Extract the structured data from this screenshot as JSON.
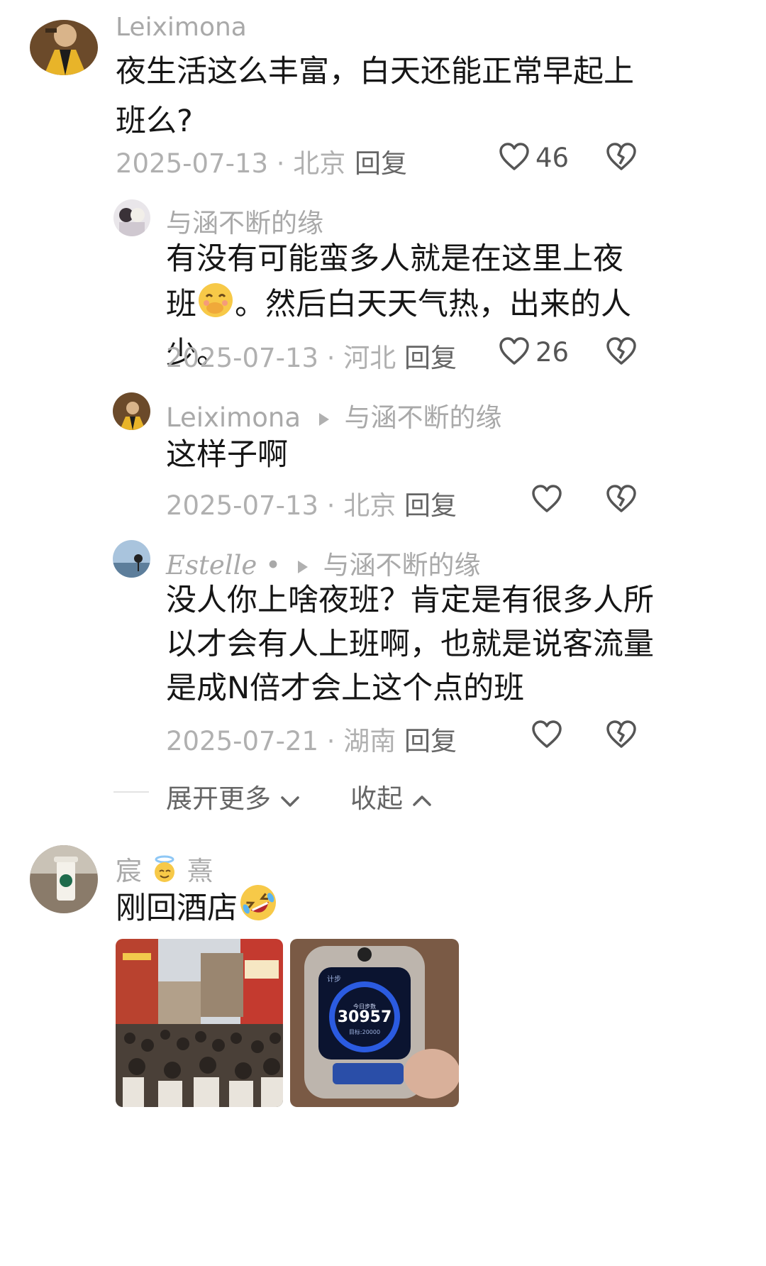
{
  "comments": [
    {
      "username": "Leiximona",
      "text": "夜生活这么丰富，白天还能正常早起上班么?",
      "meta": "2025-07-13 · 北京",
      "reply_label": "回复",
      "likes": "46",
      "replies": [
        {
          "username": "与涵不断的缘",
          "text_part1": "有没有可能蛮多人就是在这里上夜班",
          "emoji": "face-with-hand-over-mouth",
          "text_part2": "。然后白天天气热，出来的人少。",
          "meta": "2025-07-13 · 河北",
          "reply_label": "回复",
          "likes": "26"
        },
        {
          "username": "Leiximona",
          "reply_to": "与涵不断的缘",
          "text": "这样子啊",
          "meta": "2025-07-13 · 北京",
          "reply_label": "回复",
          "likes": ""
        },
        {
          "username": "Estelle •",
          "reply_to": "与涵不断的缘",
          "text": "没人你上啥夜班？肯定是有很多人所以才会有人上班啊，也就是说客流量是成N倍才会上这个点的班",
          "meta": "2025-07-21 · 湖南",
          "reply_label": "回复",
          "likes": ""
        }
      ],
      "expand_more": "展开更多",
      "collapse": "收起"
    },
    {
      "username_part1": "宸",
      "username_emoji": "smiling-face-with-halo",
      "username_part2": "熹",
      "text": "刚回酒店",
      "text_emoji": "rolling-on-the-floor-laughing",
      "images": [
        {
          "alt": "crowded-street-photo"
        },
        {
          "alt": "smartwatch-steps-photo",
          "watch_title": "今日步数",
          "steps": "30957",
          "goal": "目标:20000",
          "corner_label": "计步"
        }
      ]
    }
  ],
  "colors": {
    "text": "#161616",
    "meta": "#b0b0b0",
    "username": "#a9a9a9",
    "icon": "#555555"
  }
}
